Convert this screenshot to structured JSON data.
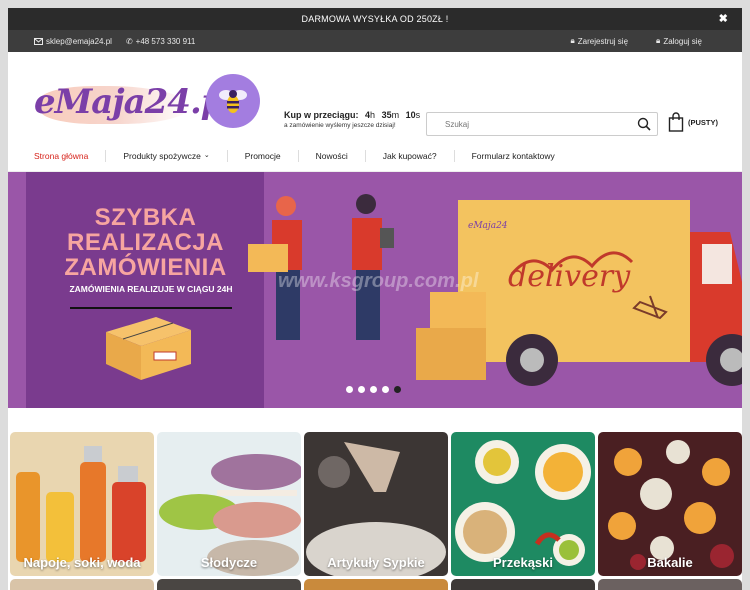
{
  "promo": {
    "text": "DARMOWA WYSYŁKA OD 250ZŁ !",
    "close_icon": "close-icon"
  },
  "topbar": {
    "email": "sklep@emaja24.pl",
    "phone": "+48 573 330 911",
    "register": "Zarejestruj się",
    "login": "Zaloguj się"
  },
  "logo": {
    "text": "eMaja24.pl"
  },
  "countdown": {
    "label": "Kup w przeciągu:",
    "hours": "4",
    "hours_unit": "h",
    "minutes": "35",
    "minutes_unit": "m",
    "seconds": "10",
    "seconds_unit": "s",
    "subtext": "a zamówienie wyślemy jeszcze dzisiaj!"
  },
  "search": {
    "placeholder": "Szukaj"
  },
  "cart": {
    "label": "(PUSTY)"
  },
  "nav": {
    "items": [
      {
        "label": "Strona główna"
      },
      {
        "label": "Produkty spożywcze"
      },
      {
        "label": "Promocje"
      },
      {
        "label": "Nowości"
      },
      {
        "label": "Jak kupować?"
      },
      {
        "label": "Formularz kontaktowy"
      }
    ]
  },
  "banner": {
    "headline": "SZYBKA REALIZACJA ZAMÓWIENIA",
    "subtext": "ZAMÓWIENIA REALIZUJE W CIĄGU 24H",
    "truck_text": "delivery",
    "truck_brand": "eMaja24",
    "watermark": "www.ksgroup.com.pl",
    "active_slide": 5,
    "slide_count": 5
  },
  "categories": [
    {
      "label": "Napoje, soki, woda",
      "color": "#c9752a"
    },
    {
      "label": "Słodycze",
      "color": "#c77f8e"
    },
    {
      "label": "Artykuły Sypkie",
      "color": "#3a3533"
    },
    {
      "label": "Przekąski",
      "color": "#1f7a5a"
    },
    {
      "label": "Bakalie",
      "color": "#7a3a30"
    }
  ],
  "colors": {
    "accent": "#d7241c",
    "banner": "#9a56a8",
    "panel": "#7a3b8e",
    "brand": "#7b3fa8"
  }
}
